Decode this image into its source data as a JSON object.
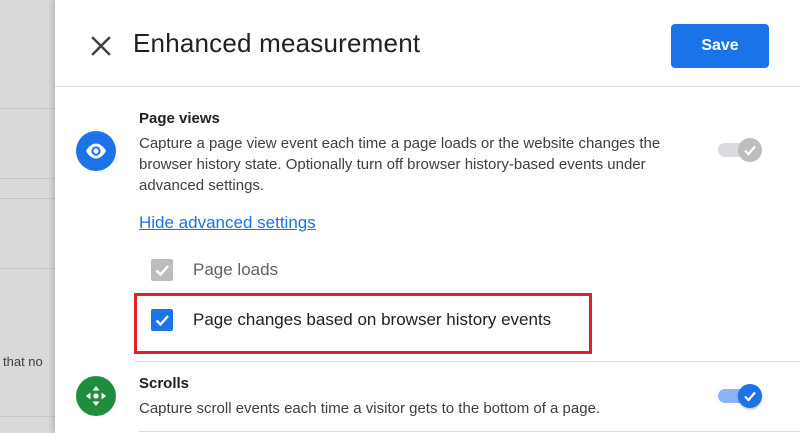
{
  "header": {
    "title": "Enhanced measurement",
    "save_label": "Save"
  },
  "background": {
    "peek_text": "that no"
  },
  "page_views": {
    "title": "Page views",
    "description": "Capture a page view event each time a page loads or the website changes the browser history state. Optionally turn off browser history-based events under advanced settings.",
    "icon": "eye-icon",
    "toggle_on": true,
    "toggle_disabled": true,
    "advanced_link": "Hide advanced settings",
    "options": [
      {
        "label": "Page loads",
        "checked": true,
        "disabled": true
      },
      {
        "label": "Page changes based on browser history events",
        "checked": true,
        "disabled": false
      }
    ]
  },
  "scrolls": {
    "title": "Scrolls",
    "description": "Capture scroll events each time a visitor gets to the bottom of a page.",
    "icon": "scroll-arrows-icon",
    "toggle_on": true
  },
  "colors": {
    "accent": "#1a73e8",
    "scroll_icon_bg": "#1e8e3e",
    "highlight": "#e0202a"
  }
}
